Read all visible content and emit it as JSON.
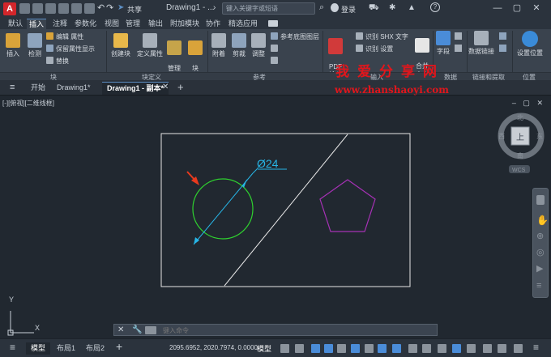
{
  "titlebar": {
    "app_logo": "A",
    "share_label": "共享",
    "title": "Drawing1 - ...",
    "search_placeholder": "键入关键字或短语",
    "login_label": "登录"
  },
  "ribbon_tabs": [
    "默认",
    "插入",
    "注释",
    "参数化",
    "视图",
    "管理",
    "输出",
    "附加模块",
    "协作",
    "精选应用"
  ],
  "active_ribbon_tab": "插入",
  "ribbon": {
    "insert": "插入",
    "check": "检测",
    "edit_attr": "编辑 属性",
    "keep_attr": "保留属性显示",
    "replace": "替换",
    "create_block": "创建块",
    "define_attr": "定义属性",
    "manage_attr": "管理\n属性",
    "block_editor": "块\n编辑器",
    "attach": "附着",
    "clip": "剪裁",
    "adjust": "调整",
    "underlay_layers": "参考底图图层",
    "pdf_import": "PDF\n输入",
    "recognize_shx": "识别 SHX 文字",
    "recognize_settings": "识别 设置",
    "merge_text": "合并\n文字",
    "field": "字段",
    "data_link": "数据链接",
    "set_location": "设置位置"
  },
  "panel_titles": {
    "block": "块",
    "block_def": "块定义",
    "reference": "参考",
    "import": "输入",
    "data": "数据",
    "link_extract": "链接和提取",
    "location": "位置"
  },
  "watermark": {
    "main": "我爱分享网",
    "url": "www.zhanshaoyi.com"
  },
  "doc_tabs": [
    "开始",
    "Drawing1*",
    "Drawing1 - 副本*"
  ],
  "active_doc_tab": "Drawing1 - 副本*",
  "viewport": {
    "label": "[-][俯视][二维线框]",
    "dimension_text": "Ø24"
  },
  "viewcube": {
    "top": "上",
    "north": "北",
    "south": "南",
    "east": "东",
    "west": "西",
    "wcs": "WCS"
  },
  "ucs": {
    "y": "Y",
    "x": "X"
  },
  "commandline": {
    "placeholder": "键入命令"
  },
  "statusbar": {
    "layout_tabs": [
      "模型",
      "布局1",
      "布局2"
    ],
    "active_layout": "模型",
    "coords": "2095.6952, 2020.7974, 0.0000",
    "model_label": "模型"
  },
  "colors": {
    "background": "#212830",
    "circle": "#2fd12f",
    "dimension": "#27b5e6",
    "pentagon": "#a631b5",
    "arrow": "#e83a1e",
    "frame": "#e6e6e6",
    "watermark": "#e0161c"
  }
}
